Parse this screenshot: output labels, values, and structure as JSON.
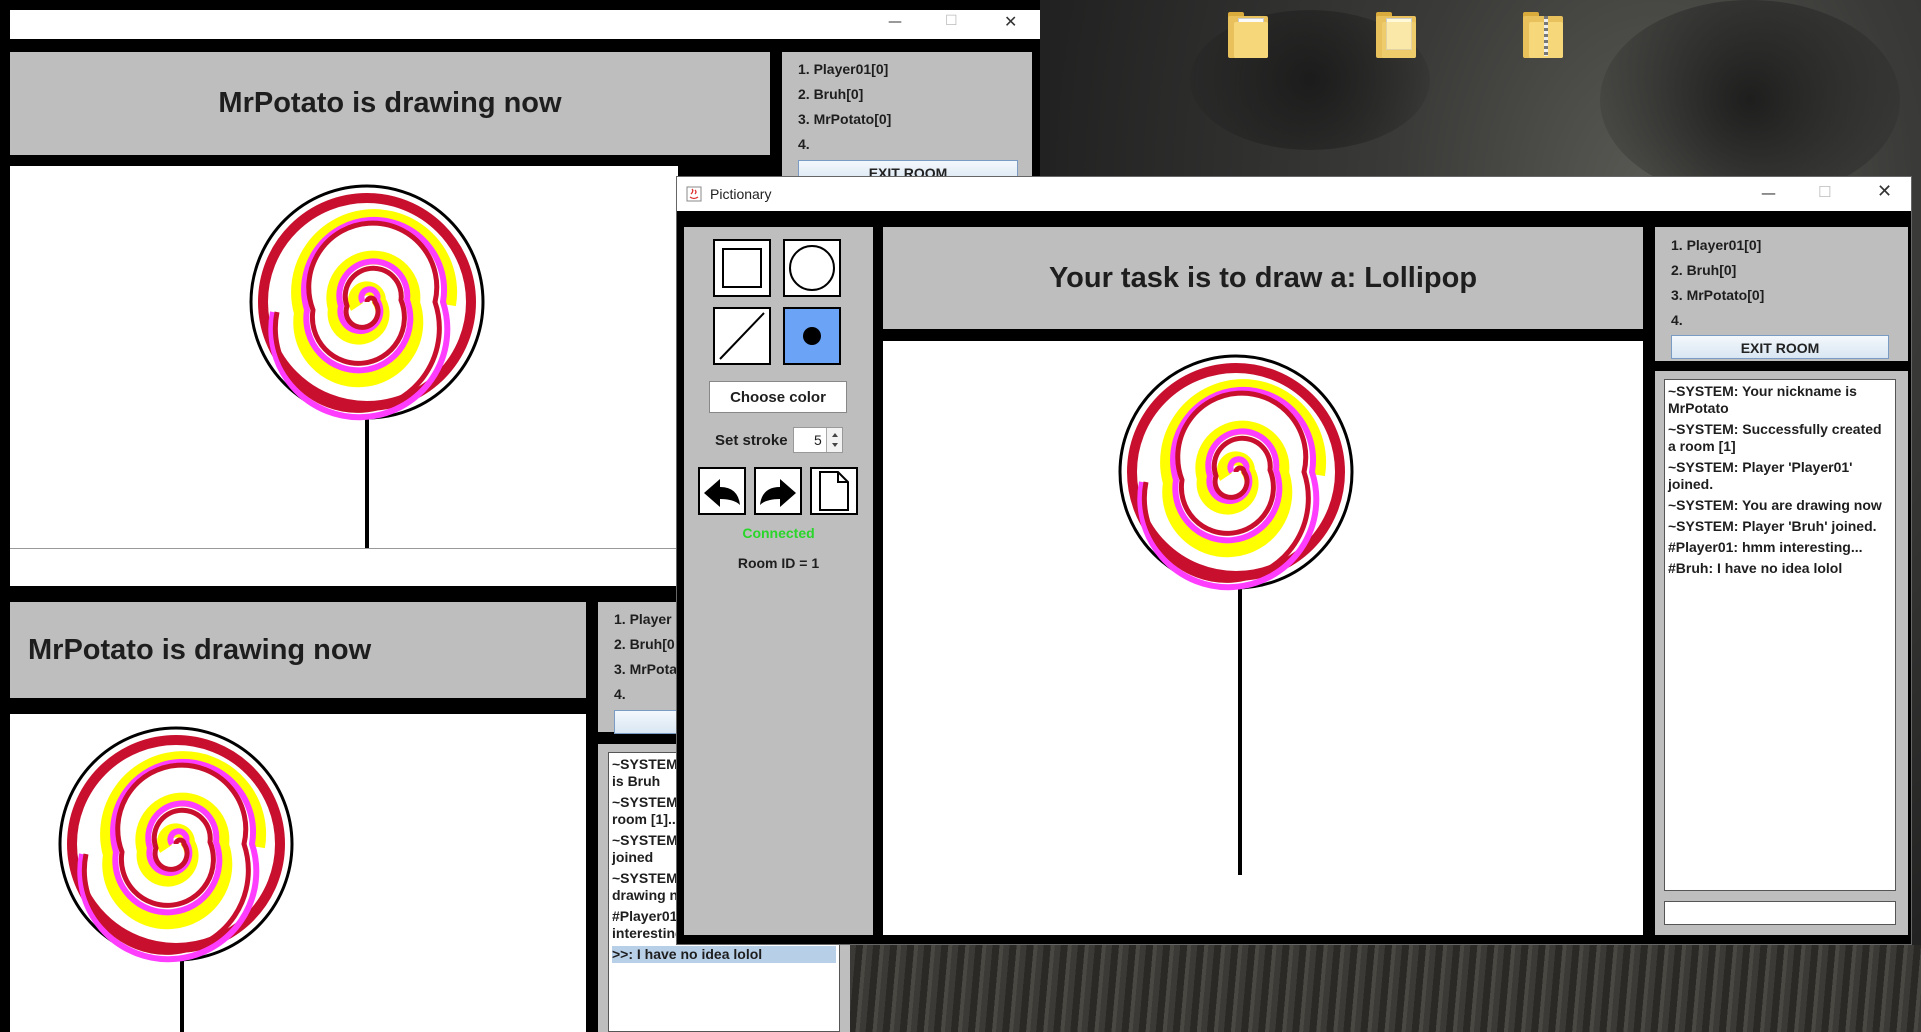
{
  "colors": {
    "panel": "#bebebe",
    "accent": "#6ba3f6",
    "connected": "#29d629",
    "lollipop_red": "#c8102e",
    "lollipop_pink": "#ff3dff",
    "lollipop_yellow": "#ffff00"
  },
  "back_window": {
    "title_bar": {
      "minimize": "—",
      "maximize": "☐",
      "close": "✕"
    },
    "header": "MrPotato is drawing now",
    "players": [
      "1. Player01[0]",
      "2. Bruh[0]",
      "3. MrPotato[0]",
      "4."
    ],
    "exit_label": "EXIT ROOM"
  },
  "left_window": {
    "header": "MrPotato is drawing now",
    "players": [
      "1. Player",
      "2. Bruh[0",
      "3. MrPota",
      "4."
    ],
    "chat": [
      "~SYSTEM",
      "is Bruh",
      "~SYSTEM",
      "room [1]...",
      "~SYSTEM",
      "joined",
      "~SYSTEM",
      "drawing n",
      "#Player01",
      "interesting..."
    ],
    "chat_selected": ">>: I have no idea lolol"
  },
  "main_window": {
    "title": "Pictionary",
    "title_bar": {
      "minimize": "—",
      "maximize": "☐",
      "close": "✕"
    },
    "header": "Your task is to draw a: Lollipop",
    "tools": {
      "rectangle": "rectangle-tool",
      "oval": "oval-tool",
      "line": "line-tool",
      "brush": "brush-tool"
    },
    "choose_color": "Choose color",
    "set_stroke_label": "Set stroke",
    "stroke_value": "5",
    "status": "Connected",
    "room_id": "Room ID = 1",
    "players": [
      "1. Player01[0]",
      "2. Bruh[0]",
      "3. MrPotato[0]",
      "4."
    ],
    "exit_label": "EXIT ROOM",
    "chat": [
      "~SYSTEM: Your nickname is MrPotato",
      "~SYSTEM: Successfully created a room [1]",
      "~SYSTEM: Player 'Player01' joined.",
      "~SYSTEM: You are drawing now",
      "~SYSTEM: Player 'Bruh' joined.",
      "#Player01: hmm interesting...",
      "#Bruh: I have no idea lolol"
    ],
    "chat_input": ""
  }
}
